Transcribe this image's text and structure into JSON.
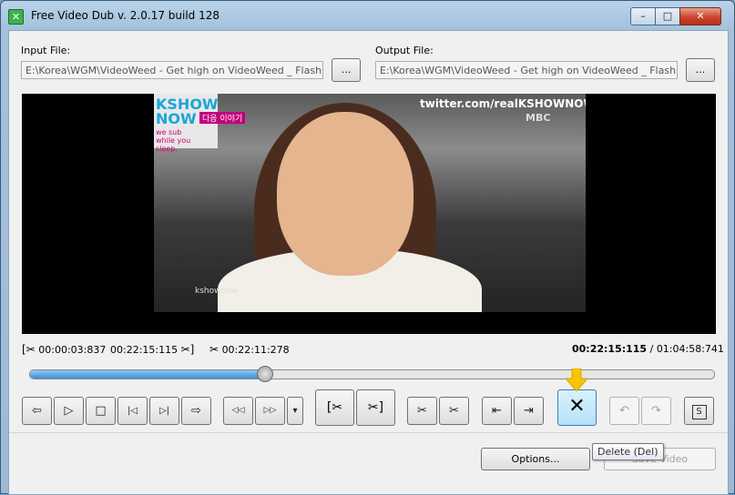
{
  "window": {
    "title": "Free Video Dub  v. 2.0.17 build 128",
    "controls": {
      "minimize": "–",
      "maximize": "□",
      "close": "✕"
    }
  },
  "input": {
    "label": "Input File:",
    "value": "E:\\Korea\\WGM\\VideoWeed - Get high on VideoWeed _ Flash Video H",
    "browse": "..."
  },
  "output": {
    "label": "Output File:",
    "value": "E:\\Korea\\WGM\\VideoWeed - Get high on VideoWeed _ Flash Video H",
    "browse": "..."
  },
  "video": {
    "overlay_top_left": "KSHOW\nNOW",
    "overlay_sub": "we sub\nwhile you\nsleep.",
    "overlay_korean": "다음 이야기",
    "overlay_twitter": "twitter.com/realKSHOWNOW",
    "overlay_mbc": "MBC",
    "overlay_watermark": "kshownow"
  },
  "selection": {
    "start": "00:00:03:837",
    "end": "00:22:15:115",
    "length": "00:22:11:278"
  },
  "position": {
    "current": "00:22:15:115",
    "separator": "/",
    "total": "01:04:58:741",
    "progress_fraction": 0.342,
    "marker_fraction": 0.8
  },
  "controls": {
    "prev_frame": "⇦",
    "play": "▷",
    "stop": "□",
    "to_start": "|◁",
    "to_end": "▷|",
    "next_frame": "⇨",
    "rewind": "◁◁",
    "forward": "▷▷",
    "dropdown": "▾",
    "set_start": "[✂",
    "set_end": "✂]",
    "to_sel_start": "⇤",
    "to_sel_end": "⇥",
    "delete": "✕",
    "undo": "↶",
    "redo": "↷",
    "save_icon": "S",
    "scissor1": "✂",
    "scissor2": "✂"
  },
  "footer": {
    "options": "Options...",
    "save": "Save Video",
    "tooltip": "Delete (Del)"
  },
  "colors": {
    "accent": "#3e8fd4",
    "arrow": "#f6c400"
  }
}
